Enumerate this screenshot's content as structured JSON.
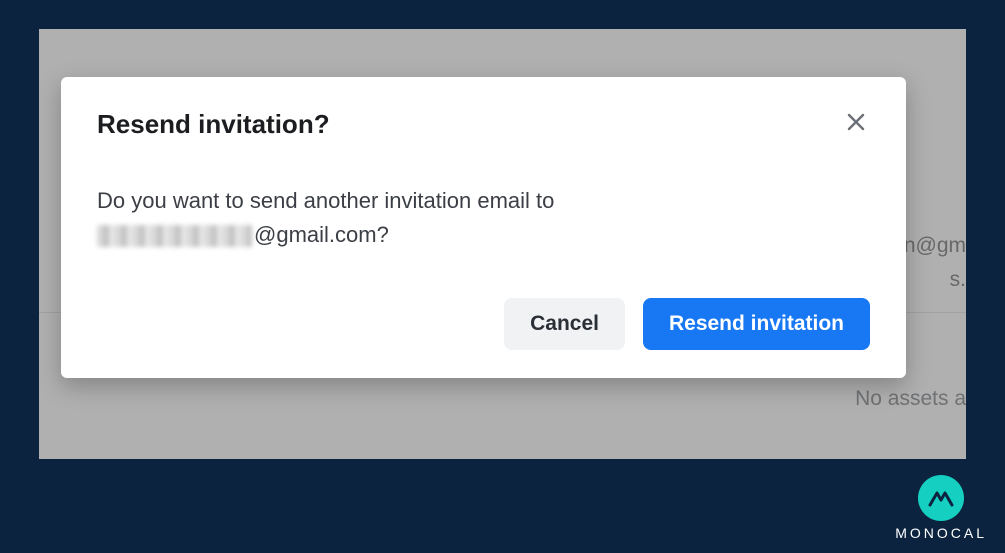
{
  "dialog": {
    "title": "Resend invitation?",
    "body_prefix": "Do you want to send another invitation email to ",
    "email_domain": "@gmail.com?",
    "cancel_label": "Cancel",
    "confirm_label": "Resend invitation"
  },
  "background": {
    "line1": "n@gm",
    "line2": "s.",
    "no_assets": "No assets a"
  },
  "brand": {
    "name": "MONOCAL"
  }
}
